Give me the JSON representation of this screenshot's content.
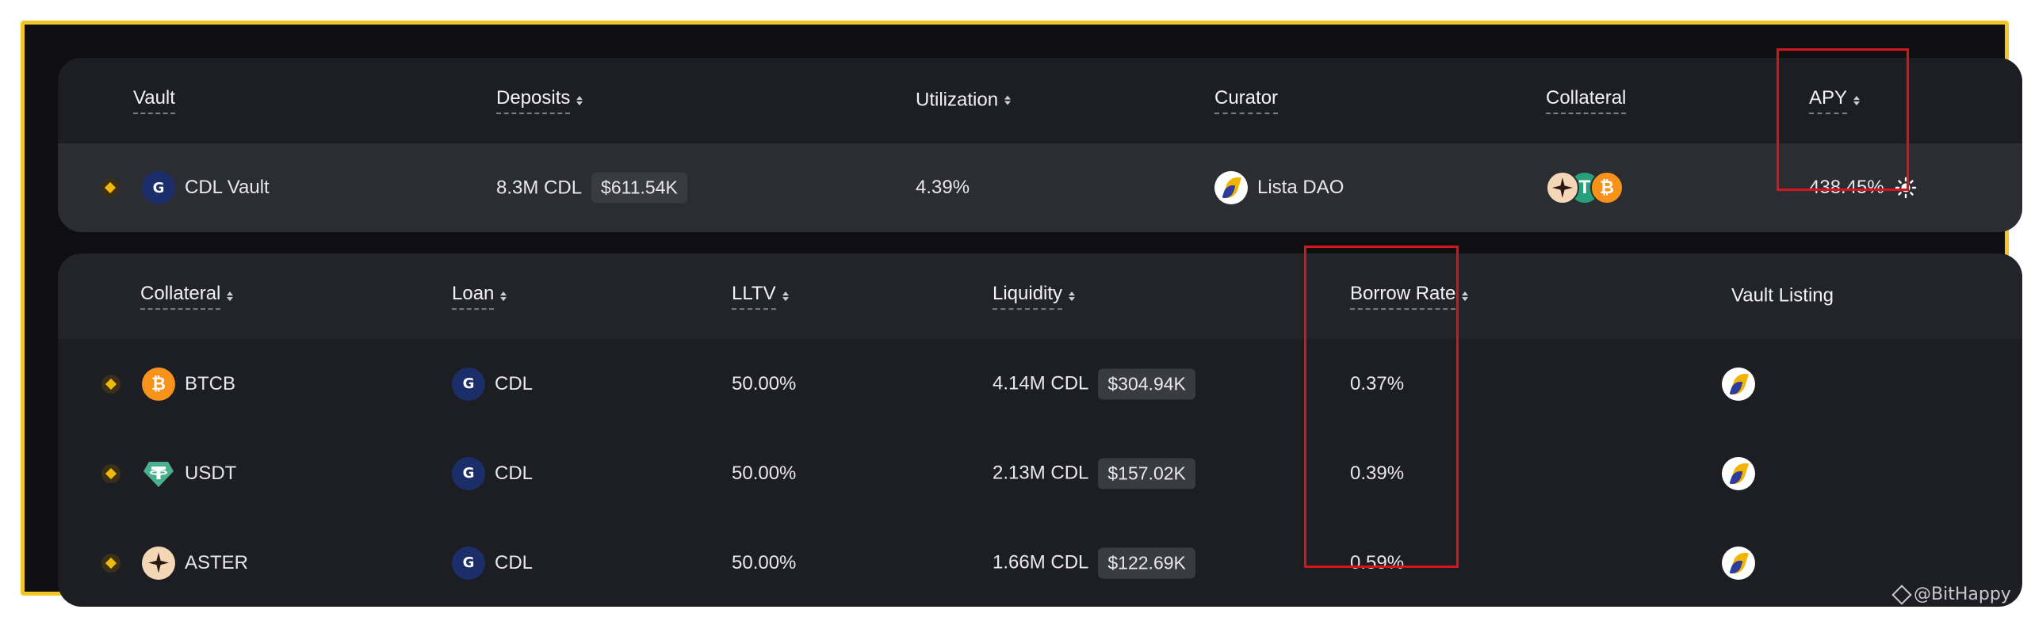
{
  "vault_table": {
    "headers": {
      "vault": "Vault",
      "deposits": "Deposits",
      "utilization": "Utilization",
      "curator": "Curator",
      "collateral": "Collateral",
      "apy": "APY"
    },
    "row": {
      "vault_name": "CDL Vault",
      "deposits_amount": "8.3M CDL",
      "deposits_usd": "$611.54K",
      "utilization": "4.39%",
      "curator": "Lista DAO",
      "apy": "438.45%",
      "collateral_icons": [
        "aster-icon",
        "tether-icon",
        "bitcoin-icon"
      ]
    }
  },
  "market_table": {
    "headers": {
      "collateral": "Collateral",
      "loan": "Loan",
      "lltv": "LLTV",
      "liquidity": "Liquidity",
      "borrow_rate": "Borrow Rate",
      "vault_listing": "Vault Listing"
    },
    "rows": [
      {
        "collateral": "BTCB",
        "loan": "CDL",
        "lltv": "50.00%",
        "liquidity": "4.14M CDL",
        "liquidity_usd": "$304.94K",
        "borrow_rate": "0.37%"
      },
      {
        "collateral": "USDT",
        "loan": "CDL",
        "lltv": "50.00%",
        "liquidity": "2.13M CDL",
        "liquidity_usd": "$157.02K",
        "borrow_rate": "0.39%"
      },
      {
        "collateral": "ASTER",
        "loan": "CDL",
        "lltv": "50.00%",
        "liquidity": "1.66M CDL",
        "liquidity_usd": "$122.69K",
        "borrow_rate": "0.59%"
      }
    ]
  },
  "watermark": "@BitHappy",
  "colors": {
    "frame_border": "#f3c623",
    "highlight_box": "#d5141b",
    "background": "#0f0f12",
    "bnb_gold": "#f0b90b"
  }
}
